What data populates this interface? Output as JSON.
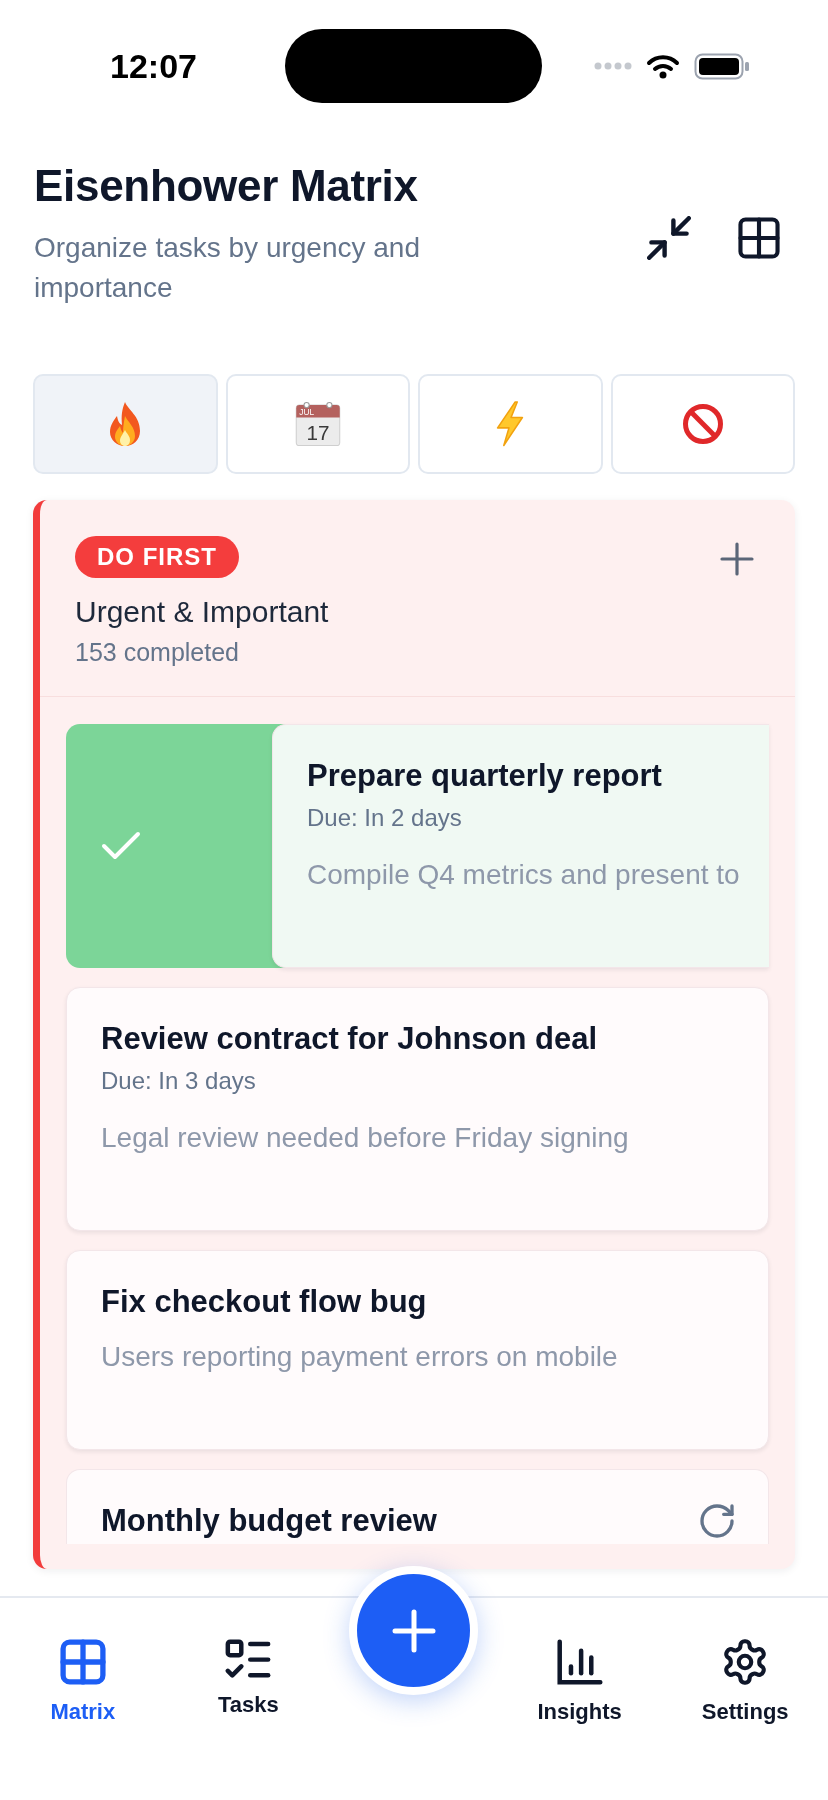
{
  "status_bar": {
    "time": "12:07"
  },
  "header": {
    "title": "Eisenhower Matrix",
    "subtitle": "Organize tasks by urgency and importance"
  },
  "quadrant_tabs": [
    {
      "kind": "fire",
      "selected": true
    },
    {
      "kind": "calendar",
      "selected": false,
      "month": "JUL",
      "day": "17"
    },
    {
      "kind": "lightning",
      "selected": false
    },
    {
      "kind": "prohibited",
      "selected": false
    }
  ],
  "quadrant": {
    "badge": "DO FIRST",
    "title": "Urgent & Important",
    "completed": "153 completed",
    "tasks": [
      {
        "title": "Prepare quarterly report",
        "due": "Due: In 2 days",
        "description": "Compile Q4 metrics and present to",
        "swiped": true,
        "recurring": false
      },
      {
        "title": "Review contract for Johnson deal",
        "due": "Due: In 3 days",
        "description": "Legal review needed before Friday signing",
        "swiped": false,
        "recurring": false
      },
      {
        "title": "Fix checkout flow bug",
        "description": "Users reporting payment errors on mobile",
        "swiped": false,
        "recurring": false
      },
      {
        "title": "Monthly budget review",
        "swiped": false,
        "recurring": true
      }
    ]
  },
  "tab_bar": {
    "items": [
      {
        "kind": "grid",
        "label": "Matrix",
        "selected": true
      },
      {
        "kind": "checklist",
        "label": "Tasks",
        "selected": false
      },
      {
        "kind": "chart",
        "label": "Insights",
        "selected": false
      },
      {
        "kind": "gear",
        "label": "Settings",
        "selected": false
      }
    ]
  }
}
